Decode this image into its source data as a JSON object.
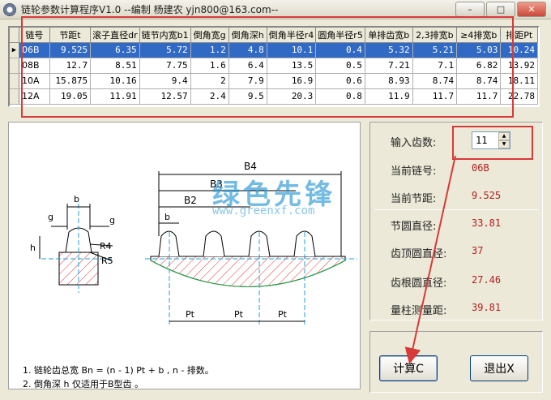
{
  "window": {
    "title": "链轮参数计算程序V1.0  --编制 杨建农 yjn800@163.com--",
    "minimize": "–",
    "maximize": "□",
    "close": "✕"
  },
  "table": {
    "headers": [
      "链号",
      "节距t",
      "滚子直径dr",
      "链节内宽b1",
      "倒角宽g",
      "倒角深h",
      "倒角半径r4",
      "圆角半径r5",
      "单排齿宽b",
      "2,3排宽b",
      "≥4排宽b",
      "排距Pt"
    ],
    "rows": [
      [
        "06B",
        "9.525",
        "6.35",
        "5.72",
        "1.2",
        "4.8",
        "10.1",
        "0.4",
        "5.32",
        "5.21",
        "5.03",
        "10.24"
      ],
      [
        "08B",
        "12.7",
        "8.51",
        "7.75",
        "1.6",
        "6.4",
        "13.5",
        "0.5",
        "7.21",
        "7.1",
        "6.82",
        "13.92"
      ],
      [
        "10A",
        "15.875",
        "10.16",
        "9.4",
        "2",
        "7.9",
        "16.9",
        "0.6",
        "8.93",
        "8.74",
        "8.74",
        "18.11"
      ],
      [
        "12A",
        "19.05",
        "11.91",
        "12.57",
        "2.4",
        "9.5",
        "20.3",
        "0.8",
        "11.9",
        "11.7",
        "11.7",
        "22.78"
      ]
    ],
    "selected_row": 0,
    "indicator": "▶"
  },
  "diagram": {
    "labels": {
      "b": "b",
      "g": "g",
      "h": "h",
      "r4": "R4",
      "r5": "R5",
      "b4": "B4",
      "b3": "B3",
      "b2": "B2",
      "pt": "Pt"
    }
  },
  "notes": {
    "line1": "1. 链轮齿总宽  Bn = (n - 1) Pt  + b , n - 排数。",
    "line2": "2. 倒角深 h 仅适用于B型齿 。"
  },
  "inputs": {
    "teeth_label": "输入齿数:",
    "teeth_value": "11",
    "spin_up": "▲",
    "spin_down": "▼"
  },
  "results": {
    "chain_label": "当前链号:",
    "chain_value": "06B",
    "pitch_label": "当前节距:",
    "pitch_value": "9.525",
    "pitch_circle_label": "节圆直径:",
    "pitch_circle_value": "33.81",
    "tip_circle_label": "齿顶圆直径:",
    "tip_circle_value": "37",
    "root_circle_label": "齿根圆直径:",
    "root_circle_value": "27.46",
    "measure_label": "量柱测量距:",
    "measure_value": "39.81"
  },
  "buttons": {
    "calc": "计算C",
    "exit": "退出X"
  },
  "watermark": {
    "text": "绿色先锋",
    "url": "www.greenxf.com"
  },
  "colors": {
    "selection": "#316ac5",
    "annotation_red": "#d83a3a",
    "value_red": "#b02020"
  }
}
